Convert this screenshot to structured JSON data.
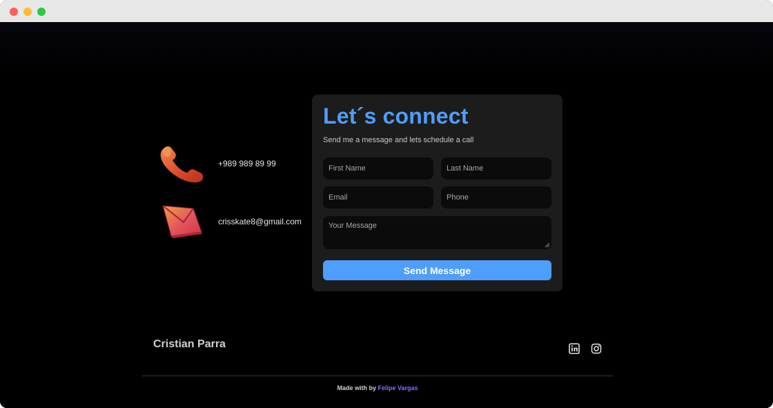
{
  "window": {
    "controls": [
      "close",
      "minimize",
      "maximize"
    ]
  },
  "contact": {
    "phone": {
      "icon": "phone-icon",
      "text": "+989 989 89 99"
    },
    "email": {
      "icon": "envelope-icon",
      "text": "crisskate8@gmail.com"
    }
  },
  "form": {
    "title": "Let´s connect",
    "subtitle": "Send me a message and lets schedule a call",
    "first_name_placeholder": "First Name",
    "last_name_placeholder": "Last Name",
    "email_placeholder": "Email",
    "phone_placeholder": "Phone",
    "message_placeholder": "Your Message",
    "submit_label": "Send Message"
  },
  "footer": {
    "name": "Cristian Parra",
    "social": [
      "linkedin-icon",
      "instagram-icon"
    ],
    "credits_prefix": "Made with by",
    "credits_author": "Felipe Vargas"
  },
  "colors": {
    "accent": "#4f9dfc",
    "author_link": "#7f72f5",
    "card_bg": "#1c1c1c",
    "page_bg": "#000000"
  }
}
